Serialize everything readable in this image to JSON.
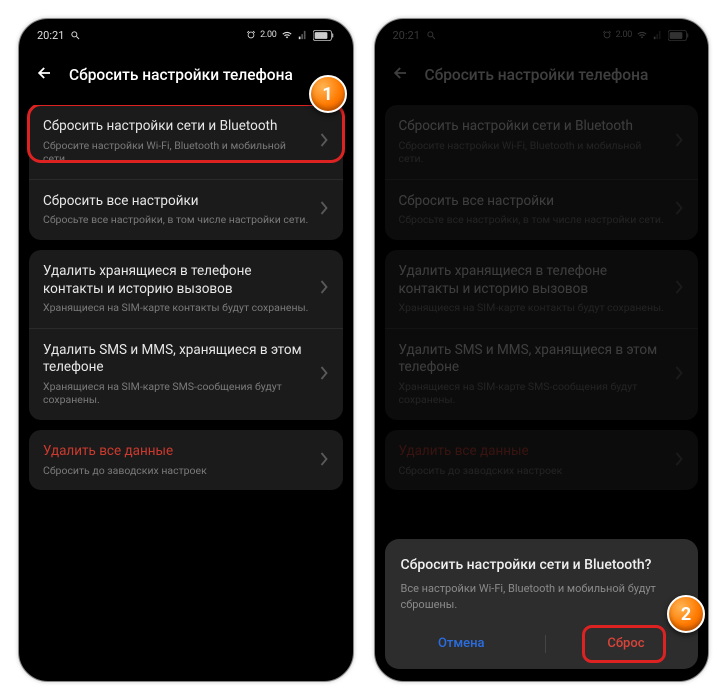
{
  "status": {
    "time": "20:21",
    "indicators": "2.00"
  },
  "header": {
    "title": "Сбросить настройки телефона"
  },
  "groups": [
    {
      "items": [
        {
          "title": "Сбросить настройки сети и Bluetooth",
          "sub": "Сбросите настройки Wi-Fi, Bluetooth и мобильной сети."
        },
        {
          "title": "Сбросить все настройки",
          "sub": "Сбросьте все настройки, в том числе настройки сети."
        }
      ]
    },
    {
      "items": [
        {
          "title": "Удалить хранящиеся в телефоне контакты и историю вызовов",
          "sub": "Хранящиеся на SIM-карте контакты будут сохранены."
        },
        {
          "title": "Удалить SMS и MMS, хранящиеся в этом телефоне",
          "sub": "Хранящиеся на SIM-карте SMS-сообщения будут сохранены."
        }
      ]
    },
    {
      "items": [
        {
          "title": "Удалить все данные",
          "sub": "Сбросить до заводских настроек",
          "danger": true
        }
      ]
    }
  ],
  "sheet": {
    "title": "Сбросить настройки сети и Bluetooth?",
    "sub": "Все настройки Wi-Fi, Bluetooth и мобильной будут сброшены.",
    "cancel": "Отмена",
    "reset": "Сброс"
  },
  "markers": {
    "one": "1",
    "two": "2"
  }
}
